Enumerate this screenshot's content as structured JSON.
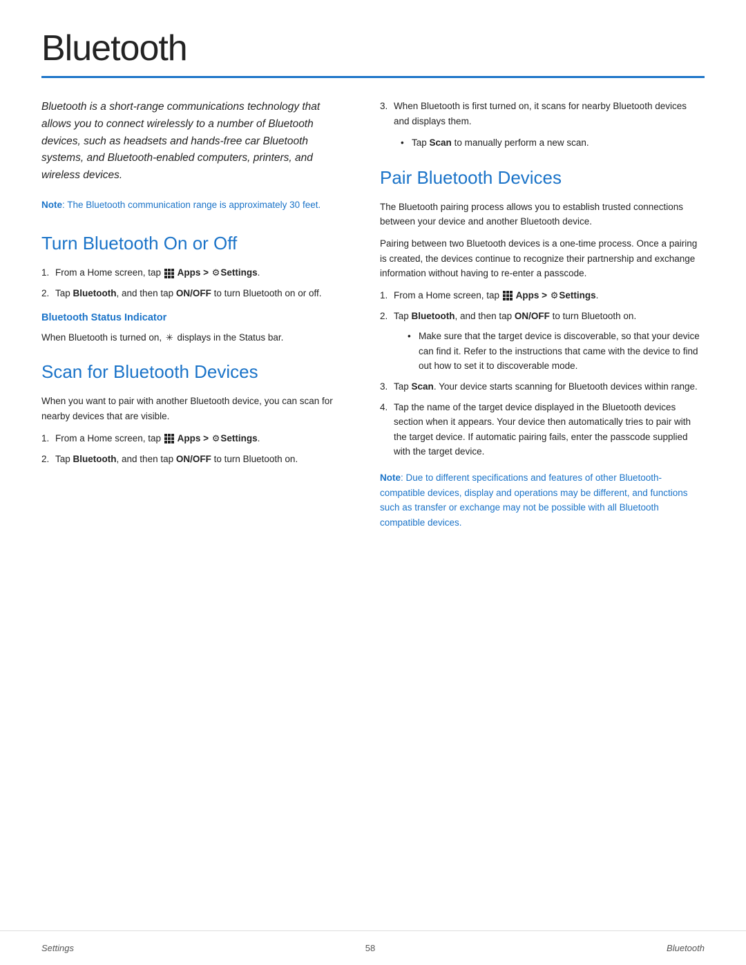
{
  "page": {
    "title": "Bluetooth",
    "title_rule_color": "#1a73c8"
  },
  "intro": {
    "text": "Bluetooth is a short-range communications technology that allows you to connect wirelessly to a number of Bluetooth devices, such as headsets and hands-free car Bluetooth systems, and Bluetooth-enabled computers, printers, and wireless devices.",
    "note_label": "Note",
    "note_text": ": The Bluetooth communication range is approximately 30 feet."
  },
  "section_turn": {
    "heading": "Turn Bluetooth On or Off",
    "step1_prefix": "From a Home screen, tap",
    "step1_apps": "Apps >",
    "step1_settings": "Settings",
    "step1_period": ".",
    "step2_text_before": "Tap ",
    "step2_bold1": "Bluetooth",
    "step2_text_mid": ", and then tap ",
    "step2_bold2": "ON/OFF",
    "step2_text_after": " to turn Bluetooth on or off.",
    "sub_heading": "Bluetooth Status Indicator",
    "sub_text": "When Bluetooth is turned on, ✶ displays in the Status bar."
  },
  "section_scan": {
    "heading": "Scan for Bluetooth Devices",
    "intro": "When you want to pair with another Bluetooth device, you can scan for nearby devices that are visible.",
    "step1_prefix": "From a Home screen, tap",
    "step1_apps": "Apps >",
    "step1_settings": "Settings",
    "step1_period": ".",
    "step2_text_before": "Tap ",
    "step2_bold1": "Bluetooth",
    "step2_text_mid": ", and then tap ",
    "step2_bold2": "ON/OFF",
    "step2_text_after": " to turn Bluetooth on."
  },
  "section_pair": {
    "heading": "Pair Bluetooth Devices",
    "intro1": "The Bluetooth pairing process allows you to establish trusted connections between your device and another Bluetooth device.",
    "intro2": "Pairing between two Bluetooth devices is a one-time process. Once a pairing is created, the devices continue to recognize their partnership and exchange information without having to re-enter a passcode.",
    "step1_prefix": "From a Home screen, tap",
    "step1_apps": "Apps >",
    "step1_settings": "Settings",
    "step1_period": ".",
    "step2_text_before": "Tap ",
    "step2_bold1": "Bluetooth",
    "step2_text_mid": ", and then tap ",
    "step2_bold2": "ON/OFF",
    "step2_text_after": " to turn Bluetooth on.",
    "step2_bullet": "Make sure that the target device is discoverable, so that your device can find it. Refer to the instructions that came with the device to find out how to set it to discoverable mode.",
    "step3_text_before": "Tap ",
    "step3_bold": "Scan",
    "step3_text_after": ". Your device starts scanning for Bluetooth devices within range.",
    "step4": "Tap the name of the target device displayed in the Bluetooth devices section when it appears. Your device then automatically tries to pair with the target device. If automatic pairing fails, enter the passcode supplied with the target device.",
    "note_label": "Note",
    "note_text": ": Due to different specifications and features of other Bluetooth-compatible devices, display and operations may be different, and functions such as transfer or exchange may not be possible with all Bluetooth compatible devices."
  },
  "right_col_scan": {
    "step3": "When Bluetooth is first turned on, it scans for nearby Bluetooth devices and displays them.",
    "step3_bullet_before": "Tap ",
    "step3_bullet_bold": "Scan",
    "step3_bullet_after": " to manually perform a new scan."
  },
  "footer": {
    "left": "Settings",
    "center": "58",
    "right": "Bluetooth"
  }
}
